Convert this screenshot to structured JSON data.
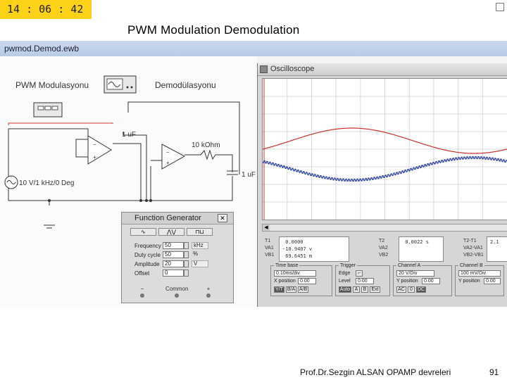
{
  "clock": "14 : 06 : 42",
  "slide_title": "PWM Modulation  Demodulation",
  "app": {
    "window_title": "pwmod.Demod.ewb",
    "labels": {
      "modulation": "PWM Modulasyonu",
      "demodulation": "Demodülasyonu",
      "cap1": "1 uF",
      "resistor": "10 kOhm",
      "cap2": "1 uF",
      "source": "10 V/1 kHz/0 Deg"
    }
  },
  "function_generator": {
    "title": "Function Generator",
    "waveforms": [
      "∿",
      "⋀⋁",
      "⊓⊔"
    ],
    "rows": [
      {
        "label": "Frequency",
        "value": "50",
        "unit": "kHz"
      },
      {
        "label": "Duty cycle",
        "value": "50",
        "unit": "%"
      },
      {
        "label": "Amplitude",
        "value": "20",
        "unit": "V"
      },
      {
        "label": "Offset",
        "value": "0",
        "unit": ""
      }
    ],
    "terminals": [
      "−",
      "Common",
      "+"
    ]
  },
  "oscilloscope": {
    "title": "Oscilloscope",
    "colors": {
      "channel_a": "#c8322c",
      "channel_b": "#2a3aa0"
    },
    "readouts": {
      "t1_labels": "T1\nVA1\nVB1",
      "t1_values": " 0.0000   \n-10.9407 v\n 69.6451 m",
      "t2_labels": "T2\nVA2\nVB2",
      "t2_values": " 0.0022 s",
      "diff_labels": "T2-T1\nVA2-VA1\nVB2-VB1",
      "diff_values": "2.1"
    },
    "timebase": {
      "title": "Time base",
      "value": "0.10ms/div",
      "xpos_label": "X position",
      "xpos_value": "0.00",
      "buttons": [
        "Y/T",
        "B/A",
        "A/B"
      ]
    },
    "trigger": {
      "title": "Trigger",
      "edge_label": "Edge",
      "level_label": "Level",
      "level_value": "0.00",
      "buttons": [
        "Auto",
        "A",
        "B",
        "Ext"
      ]
    },
    "channel_a": {
      "title": "Channel A",
      "value": "20 V/Div",
      "ypos_label": "Y position",
      "ypos_value": "0.00",
      "buttons": [
        "AC",
        "0",
        "DC"
      ]
    },
    "channel_b": {
      "title": "Channel B",
      "value": "100 mV/Div",
      "ypos_label": "Y position",
      "ypos_value": "0.00"
    }
  },
  "footer": {
    "author": "Prof.Dr.Sezgin ALSAN  OPAMP devreleri",
    "page": "91"
  }
}
